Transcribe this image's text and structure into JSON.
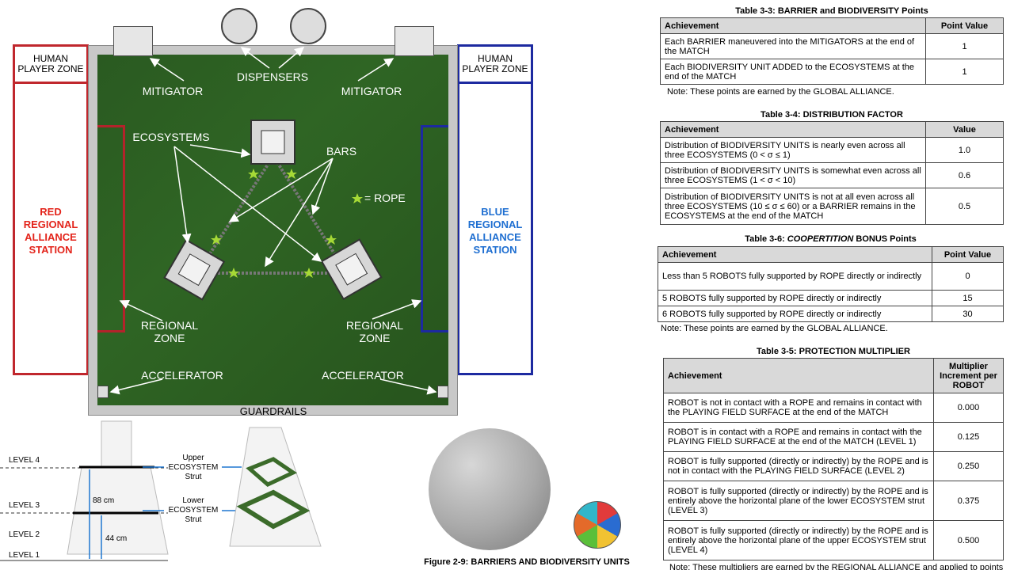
{
  "field": {
    "human_player_zone": "HUMAN\nPLAYER ZONE",
    "red_station": "RED\nREGIONAL\nALLIANCE\nSTATION",
    "blue_station": "BLUE\nREGIONAL\nALLIANCE\nSTATION",
    "dispensers": "DISPENSERS",
    "mitigator": "MITIGATOR",
    "ecosystems": "ECOSYSTEMS",
    "bars": "BARS",
    "rope_legend": "= ROPE",
    "regional_zone": "REGIONAL\nZONE",
    "accelerator": "ACCELERATOR",
    "guardrails": "GUARDRAILS",
    "colors": {
      "red": "#c0272d",
      "blue": "#1d2aa0",
      "field_green": "#2f5f23",
      "rope_star": "#a6d936"
    }
  },
  "levels": {
    "level4": "LEVEL 4",
    "level3": "LEVEL 3",
    "level2": "LEVEL 2",
    "level1": "LEVEL 1",
    "dim_88": "88 cm",
    "dim_44": "44 cm",
    "upper_strut": "Upper\nECOSYSTEM\nStrut",
    "lower_strut": "Lower\nECOSYSTEM\nStrut"
  },
  "figure_caption": "Figure 2-9: BARRIERS AND BIODIVERSITY UNITS",
  "tables": {
    "t33": {
      "title": "Table 3-3: BARRIER and BIODIVERSITY Points",
      "headers": [
        "Achievement",
        "Point Value"
      ],
      "rows": [
        [
          "Each BARRIER maneuvered into the MITIGATORS at the end of the MATCH",
          "1"
        ],
        [
          "Each BIODIVERSITY UNIT ADDED to the ECOSYSTEMS at the end of the MATCH",
          "1"
        ]
      ],
      "note": "Note: These points are earned by the GLOBAL ALLIANCE."
    },
    "t34": {
      "title": "Table 3-4: DISTRIBUTION FACTOR",
      "headers": [
        "Achievement",
        "Value"
      ],
      "rows": [
        [
          "Distribution of BIODIVERSITY UNITS is nearly even across all three ECOSYSTEMS (0 < σ ≤ 1)",
          "1.0"
        ],
        [
          "Distribution of BIODIVERSITY UNITS is somewhat even across all three ECOSYSTEMS (1 < σ < 10)",
          "0.6"
        ],
        [
          "Distribution of BIODIVERSITY UNITS is not at all even across all three ECOSYSTEMS (10 ≤ σ ≤ 60) or a BARRIER remains in the ECOSYSTEMS at the end of the MATCH",
          "0.5"
        ]
      ]
    },
    "t36": {
      "title_prefix": "Table 3-6: ",
      "title_italic": "COOPERTITION",
      "title_suffix": " BONUS Points",
      "headers": [
        "Achievement",
        "Point Value"
      ],
      "rows": [
        [
          "Less than 5 ROBOTS fully supported by ROPE directly or indirectly",
          "0"
        ],
        [
          "5 ROBOTS fully supported by ROPE directly or indirectly",
          "15"
        ],
        [
          "6 ROBOTS fully supported by ROPE directly or indirectly",
          "30"
        ]
      ],
      "note": "Note: These points are earned by the GLOBAL ALLIANCE."
    },
    "t35": {
      "title": "Table 3-5: PROTECTION MULTIPLIER",
      "headers": [
        "Achievement",
        "Multiplier Increment per ROBOT"
      ],
      "rows": [
        [
          "ROBOT is not in contact with a ROPE and remains in contact with the PLAYING FIELD SURFACE at the end of the MATCH",
          "0.000"
        ],
        [
          "ROBOT is in contact with a ROPE and remains in contact with the PLAYING FIELD SURFACE at the end of the MATCH (LEVEL 1)",
          "0.125"
        ],
        [
          "ROBOT is fully supported (directly or indirectly) by the ROPE and is not in contact with the PLAYING FIELD SURFACE (LEVEL 2)",
          "0.250"
        ],
        [
          "ROBOT is fully supported (directly or indirectly) by the ROPE and is entirely above the horizontal plane of the lower ECOSYSTEM strut (LEVEL 3)",
          "0.375"
        ],
        [
          "ROBOT is fully supported (directly or indirectly) by the ROPE and is entirely above the horizontal plane of the upper ECOSYSTEM strut (LEVEL 4)",
          "0.500"
        ]
      ],
      "note": "Note: These multipliers are earned by the REGIONAL ALLIANCE and applied to points"
    }
  }
}
